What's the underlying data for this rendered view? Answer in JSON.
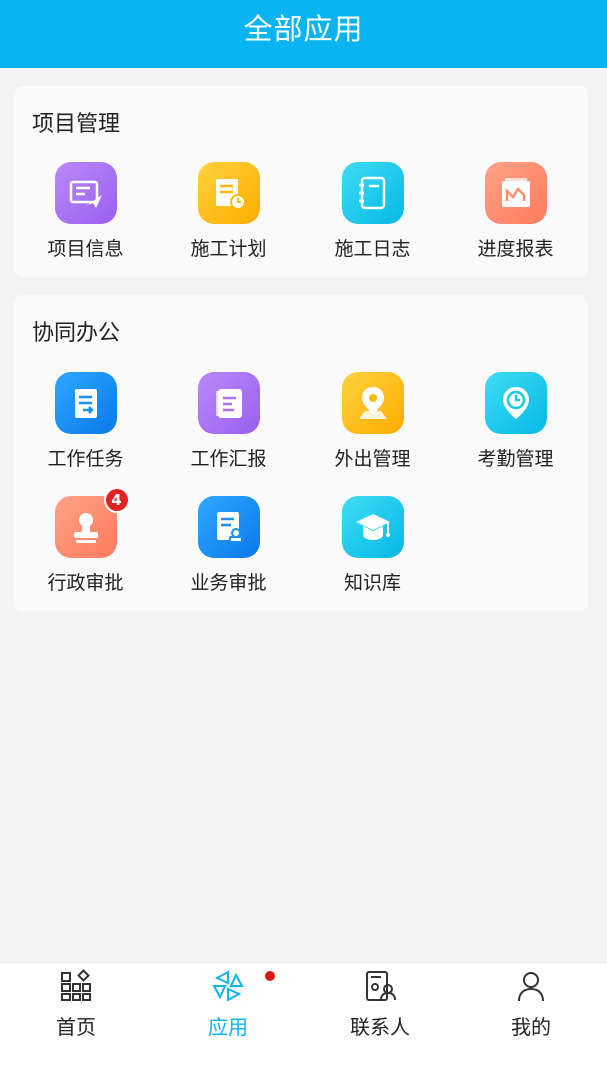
{
  "header": {
    "title": "全部应用"
  },
  "sections": [
    {
      "title": "项目管理",
      "apps": [
        {
          "label": "项目信息",
          "icon": "project-info-icon",
          "color": "#a974f5"
        },
        {
          "label": "施工计划",
          "icon": "construction-plan-icon",
          "color": "#ffc21c"
        },
        {
          "label": "施工日志",
          "icon": "construction-log-icon",
          "color": "#18c9ea"
        },
        {
          "label": "进度报表",
          "icon": "progress-report-icon",
          "color": "#ff8d6e"
        }
      ]
    },
    {
      "title": "协同办公",
      "apps": [
        {
          "label": "工作任务",
          "icon": "work-task-icon",
          "color": "#1a8ff5"
        },
        {
          "label": "工作汇报",
          "icon": "work-report-icon",
          "color": "#a974f5"
        },
        {
          "label": "外出管理",
          "icon": "outing-management-icon",
          "color": "#ffc21c"
        },
        {
          "label": "考勤管理",
          "icon": "attendance-management-icon",
          "color": "#18c9ea"
        },
        {
          "label": "行政审批",
          "icon": "admin-approval-icon",
          "color": "#ff8d6e",
          "badge": "4"
        },
        {
          "label": "业务审批",
          "icon": "business-approval-icon",
          "color": "#1a8ff5"
        },
        {
          "label": "知识库",
          "icon": "knowledge-base-icon",
          "color": "#18c9ea"
        }
      ]
    }
  ],
  "tabs": [
    {
      "label": "首页",
      "icon": "home-grid-icon"
    },
    {
      "label": "应用",
      "icon": "apps-icon",
      "active": true,
      "dot": true
    },
    {
      "label": "联系人",
      "icon": "contacts-icon"
    },
    {
      "label": "我的",
      "icon": "profile-icon"
    }
  ],
  "colors": {
    "accent": "#0ab4f0",
    "badge": "#e52222"
  }
}
